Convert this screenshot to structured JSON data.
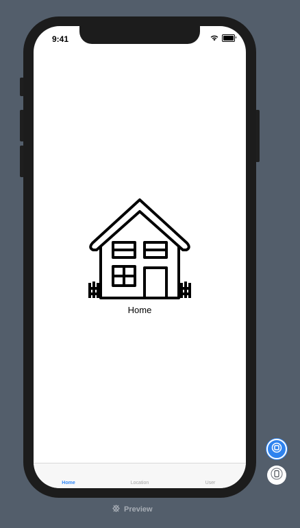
{
  "status_bar": {
    "time": "9:41"
  },
  "content": {
    "home_label": "Home"
  },
  "tab_bar": {
    "tabs": [
      {
        "label": "Home",
        "active": true
      },
      {
        "label": "Location",
        "active": false
      },
      {
        "label": "User",
        "active": false
      }
    ]
  },
  "canvas": {
    "preview_label": "Preview"
  },
  "colors": {
    "background": "#535e6b",
    "accent": "#2f86f6",
    "frame": "#1c1c1c",
    "inactive_tab": "#a3a3a3"
  },
  "icons": {
    "house": "house-icon",
    "wifi": "wifi-icon",
    "battery": "battery-icon",
    "preview": "preview-icon",
    "live": "live-preview-icon",
    "device": "device-icon"
  }
}
